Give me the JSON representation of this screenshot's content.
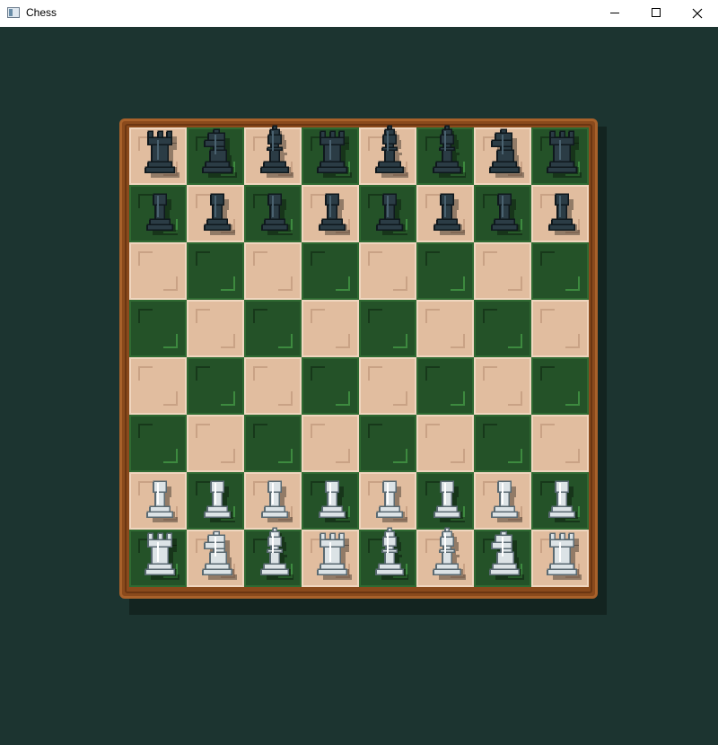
{
  "window": {
    "title": "Chess",
    "icon": "app-window-icon",
    "controls": [
      "minimize-icon",
      "maximize-icon",
      "close-icon"
    ]
  },
  "colors": {
    "background": "#1c3430",
    "light_square": "#e1bd9f",
    "dark_square": "#245228",
    "frame": "#8a4a1c",
    "black_piece": "#2b3c45",
    "white_piece": "#dce3e6"
  },
  "board": {
    "orientation": "white-bottom",
    "ranks": [
      [
        "r",
        "n",
        "b",
        "r",
        "b",
        "b",
        "n",
        "r"
      ],
      [
        "p",
        "p",
        "p",
        "p",
        "p",
        "p",
        "p",
        "p"
      ],
      [
        "",
        "",
        "",
        "",
        "",
        "",
        "",
        ""
      ],
      [
        "",
        "",
        "",
        "",
        "",
        "",
        "",
        ""
      ],
      [
        "",
        "",
        "",
        "",
        "",
        "",
        "",
        ""
      ],
      [
        "",
        "",
        "",
        "",
        "",
        "",
        "",
        ""
      ],
      [
        "P",
        "P",
        "P",
        "P",
        "P",
        "P",
        "P",
        "P"
      ],
      [
        "R",
        "N",
        "B",
        "R",
        "B",
        "B",
        "N",
        "R"
      ]
    ],
    "piece_names": {
      "p": "black-pawn",
      "r": "black-rook",
      "n": "black-knight",
      "b": "black-bishop",
      "P": "white-pawn",
      "R": "white-rook",
      "N": "white-knight",
      "B": "white-bishop"
    }
  }
}
